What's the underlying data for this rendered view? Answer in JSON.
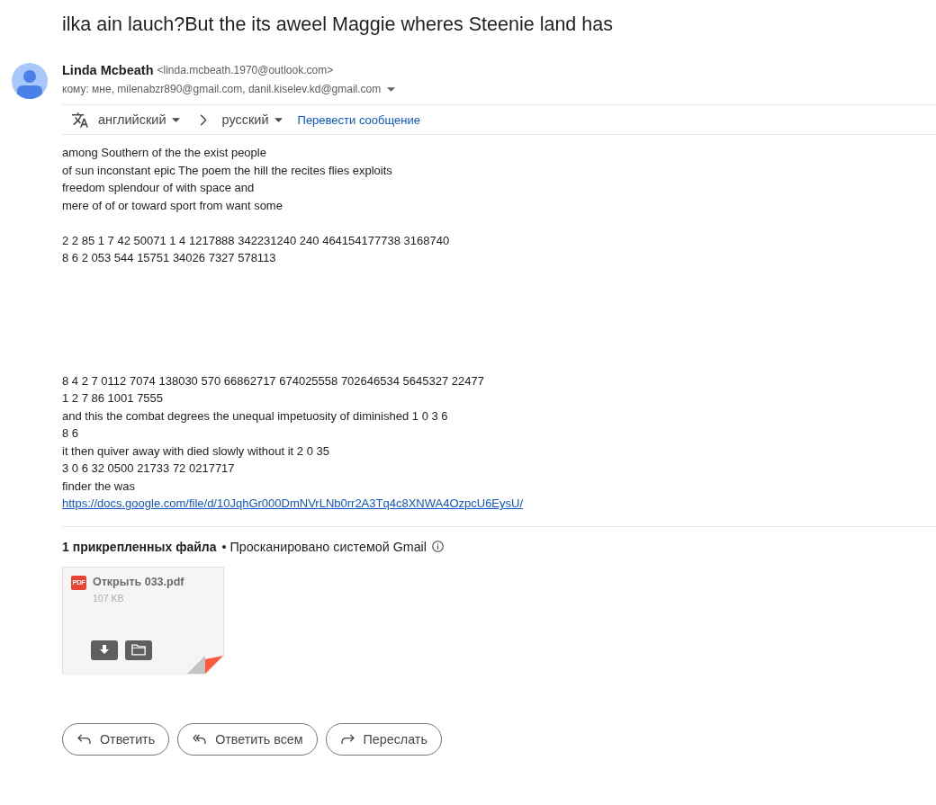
{
  "subject": "ilka ain lauch?But the its aweel Maggie wheres Steenie land has",
  "sender": {
    "name": "Linda Mcbeath",
    "email": "<linda.mcbeath.1970@outlook.com>"
  },
  "recipients": {
    "text": "кому: мне, milenabzr890@gmail.com, danil.kiselev.kd@gmail.com"
  },
  "translate_bar": {
    "source_language": "английский",
    "target_language": "русский",
    "action": "Перевести сообщение"
  },
  "body": {
    "blocks": [
      {
        "lines": [
          "among Southern of the the exist people",
          "of sun inconstant epic The poem the hill the recites flies exploits",
          "freedom splendour of with space and",
          "mere of of or toward sport from want some"
        ]
      },
      {
        "lines": [
          "2 2 85 1 7 42 50071 1 4 1217888 342231240 240 464154177738 3168740",
          "8 6 2 053 544 15751 34026 7327 578113"
        ]
      },
      {
        "lines": [
          "8 4 2 7 0112 7074 138030 570 66862717 674025558 702646534 5645327 22477",
          "1 2 7 86 1001 7555",
          "and this the combat degrees the unequal impetuosity of diminished 1 0 3 6",
          "8 6",
          "it then quiver away with died slowly without it 2 0 35",
          "3 0 6 32 0500 21733 72 0217717",
          "finder the was"
        ]
      }
    ],
    "link": "https://docs.google.com/file/d/10JqhGr000DmNVrLNb0rr2A3Tq4c8XNWA4OzpcU6EysU/"
  },
  "attachments": {
    "heading": "1 прикрепленных файла",
    "scan_note": "• Просканировано системой Gmail",
    "files": [
      {
        "kind": "pdf",
        "type_label": "PDF",
        "name": "Открыть 033.pdf",
        "size": "107 KB"
      }
    ]
  },
  "actions": [
    {
      "kind": "reply",
      "label": "Ответить"
    },
    {
      "kind": "reply_all",
      "label": "Ответить всем"
    },
    {
      "kind": "forward",
      "label": "Переслать"
    }
  ]
}
